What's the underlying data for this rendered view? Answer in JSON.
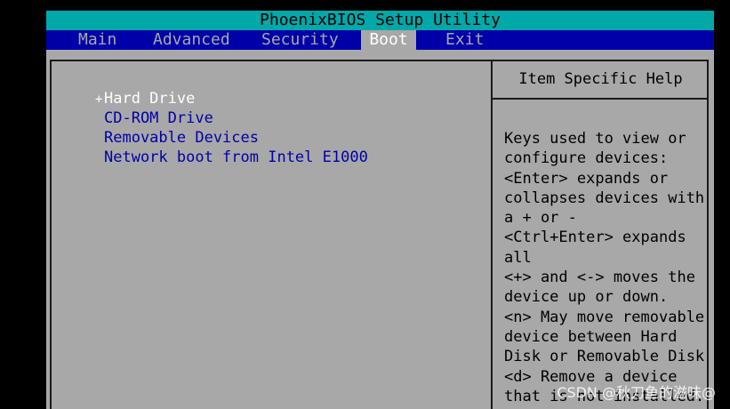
{
  "title": "PhoenixBIOS Setup Utility",
  "menu": [
    {
      "label": "Main"
    },
    {
      "label": "Advanced"
    },
    {
      "label": "Security"
    },
    {
      "label": "Boot"
    },
    {
      "label": "Exit"
    }
  ],
  "active_menu": "Boot",
  "boot_order": [
    {
      "marker": "+",
      "label": "Hard Drive"
    },
    {
      "marker": "",
      "label": "CD-ROM Drive"
    },
    {
      "marker": "",
      "label": "Removable Devices"
    },
    {
      "marker": "",
      "label": "Network boot from Intel E1000"
    }
  ],
  "selected_boot_item": "Hard Drive",
  "help": {
    "title": "Item Specific Help",
    "lines": [
      "Keys used to view or",
      "configure devices:",
      "<Enter> expands or",
      "collapses devices with",
      "a + or -",
      "<Ctrl+Enter> expands",
      "all",
      "<+> and <-> moves the",
      "device up or down.",
      "<n> May move removable",
      "device between Hard",
      "Disk or Removable Disk",
      "<d> Remove a device",
      "that is not installed."
    ]
  },
  "watermark": "CSDN @秋刀鱼的滋味@",
  "colors": {
    "title_bar": "#00a8a8",
    "menu_bar": "#0000a8",
    "panel": "#a8a8a8",
    "item_text": "#0000a8",
    "selected_text": "#ffffff"
  }
}
